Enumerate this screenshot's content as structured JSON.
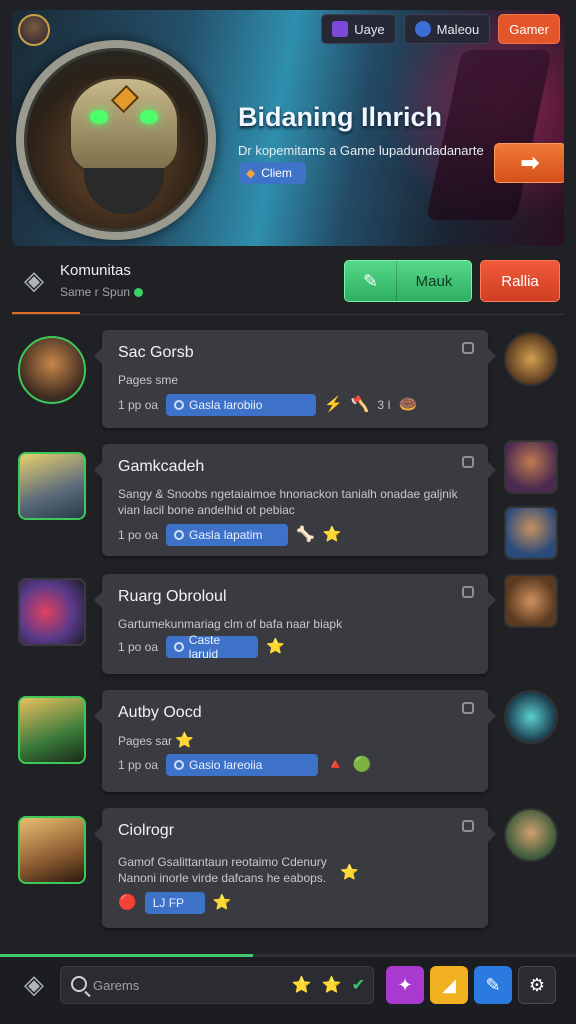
{
  "banner": {
    "title": "Bidaning Ilnrich",
    "subtitle": "Dr kopemitams a Game lupadundadanarte",
    "chip_label": "Cliem",
    "arrow_label": "➡",
    "top_buttons": [
      {
        "label": "Uaye",
        "icon": "controller-icon"
      },
      {
        "label": "Maleou",
        "icon": "globe-icon"
      },
      {
        "label": "Gamer"
      }
    ]
  },
  "community": {
    "title": "Komunitas",
    "subtitle": "Same r Spun",
    "join_label": "Mauk",
    "rally_label": "Rallia"
  },
  "feed": [
    {
      "title": "Sac Gorsb",
      "desc": "Pages sme",
      "time": "1 pp oa",
      "tag": "Gasla larobiio",
      "extras": [
        "⚡",
        "🪓",
        "3 I",
        "🍩"
      ]
    },
    {
      "title": "Gamkcadeh",
      "desc": "Sangy & Snoobs ngetaiaimoe hnonackon tanialh onadae galjnik vian lacil bone andelhid ot pebiac",
      "time": "1 po oa",
      "tag": "Gasla lapatim",
      "extras": [
        "🦴",
        "⭐"
      ]
    },
    {
      "title": "Ruarg Obroloul",
      "desc": "Gartumekunmariag clm of bafa naar biapk",
      "time": "1 po oa",
      "tag": "Caste laruid",
      "extras": [
        "⭐"
      ]
    },
    {
      "title": "Autby Oocd",
      "desc": "Pages sar",
      "time": "1 pp oa",
      "tag": "Gasio lareoiia",
      "extras": [
        "🔺",
        "🟢"
      ]
    },
    {
      "title": "Ciolrogr",
      "desc": "Gamof Gsalittantaun reotaimo Cdenury Nanoni inorle virde dafcans he eabops.",
      "time": "",
      "tag": "LJ FP",
      "extras": [
        "🔴",
        "⭐"
      ]
    }
  ],
  "bottom": {
    "search_placeholder": "Garems",
    "search_icons": [
      "⭐",
      "⭐",
      "✔"
    ],
    "progress_fraction": 0.44
  },
  "colors": {
    "accent_orange": "#e3562a",
    "accent_green": "#3fc870",
    "accent_red": "#d13e22",
    "tag_blue": "#3e72c8",
    "card_bg": "#3a3b40"
  }
}
